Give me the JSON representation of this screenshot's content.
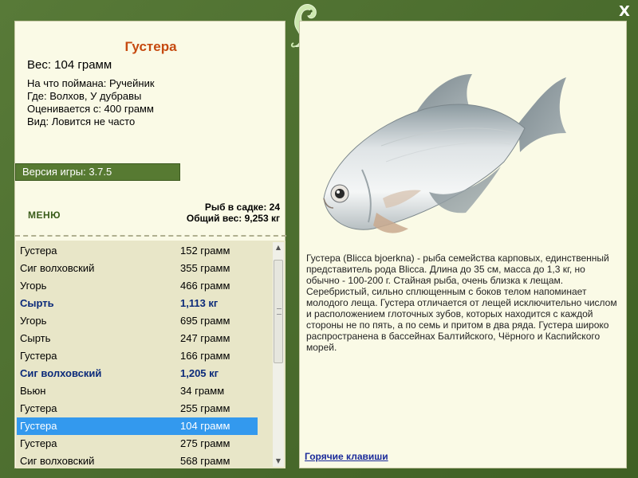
{
  "window": {
    "close_label": "X"
  },
  "fish": {
    "title": "Густера",
    "weight": "Вес: 104 грамм",
    "info": [
      "На что поймана: Ручейник",
      "Где: Волхов, У дубравы",
      "Оценивается с: 400 грамм",
      "Вид: Ловится не часто"
    ],
    "description": "Густера (Blicca bjoerkna) - рыба семейства карповых, единственный представитель рода Blicca. Длина до 35 см, масса до 1,3 кг, но обычно - 100-200 г. Стайная рыба, очень близка к лещам. Серебристый, сильно сплющенным с боков телом напоминает молодого леща. Густера отличается от лещей исключительно числом и расположением глоточных зубов, которых находится с каждой стороны не по пять, а по семь и притом в два ряда. Густера широко распространена в бассейнах Балтийского, Чёрного и Каспийского морей."
  },
  "version": "Версия игры: 3.7.5",
  "menu_label": "МЕНЮ",
  "stats": {
    "fish_count": "Рыб в садке: 24",
    "total_weight": "Общий вес: 9,253 кг"
  },
  "catch_list": [
    {
      "name": "Густера",
      "weight": "152 грамм",
      "bold": false,
      "selected": false
    },
    {
      "name": "Сиг волховский",
      "weight": "355 грамм",
      "bold": false,
      "selected": false
    },
    {
      "name": "Угорь",
      "weight": "466 грамм",
      "bold": false,
      "selected": false
    },
    {
      "name": "Сырть",
      "weight": "1,113 кг",
      "bold": true,
      "selected": false
    },
    {
      "name": "Угорь",
      "weight": "695 грамм",
      "bold": false,
      "selected": false
    },
    {
      "name": "Сырть",
      "weight": "247 грамм",
      "bold": false,
      "selected": false
    },
    {
      "name": "Густера",
      "weight": "166 грамм",
      "bold": false,
      "selected": false
    },
    {
      "name": "Сиг волховский",
      "weight": "1,205 кг",
      "bold": true,
      "selected": false
    },
    {
      "name": "Вьюн",
      "weight": "34 грамм",
      "bold": false,
      "selected": false
    },
    {
      "name": "Густера",
      "weight": "255 грамм",
      "bold": false,
      "selected": false
    },
    {
      "name": "Густера",
      "weight": "104 грамм",
      "bold": false,
      "selected": true
    },
    {
      "name": "Густера",
      "weight": "275 грамм",
      "bold": false,
      "selected": false
    },
    {
      "name": "Сиг волховский",
      "weight": "568 грамм",
      "bold": false,
      "selected": false
    }
  ],
  "hotkeys_label": "Горячие клавиши",
  "colors": {
    "frame": "#4a6b2e",
    "panel": "#fafae6",
    "title": "#c64a10",
    "list_bg": "#e8e6c8",
    "selected": "#3399ee",
    "bold_item": "#0b2a7a"
  }
}
